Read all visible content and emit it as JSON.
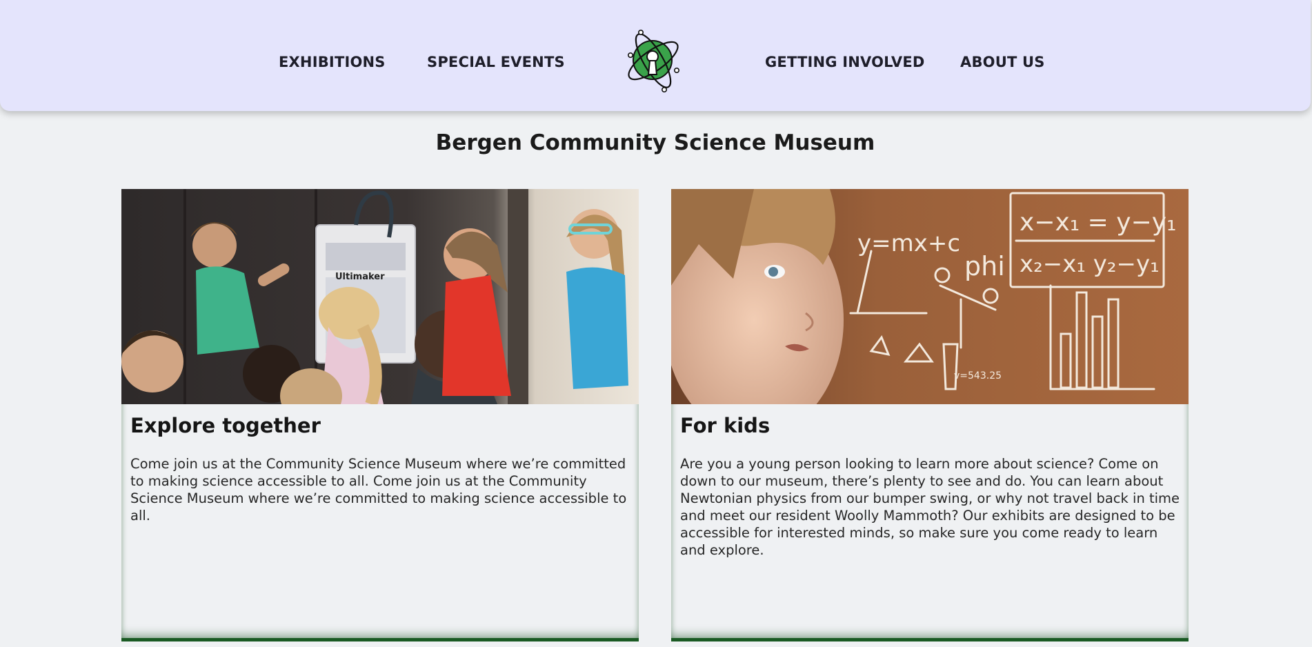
{
  "nav": {
    "exhibitions": "EXHIBITIONS",
    "special_events": "SPECIAL EVENTS",
    "getting_involved": "GETTING INVOLVED",
    "about_us": "ABOUT US",
    "logo_icon": "atom-keyhole-logo-icon"
  },
  "page": {
    "title": "Bergen Community Science Museum"
  },
  "cards": [
    {
      "heading": "Explore together",
      "body": "Come join us at the Community Science Museum where we’re committed to making science accessible to all. Come join us at the Community Science Museum where we’re committed to making science accessible to all.",
      "image_icon": "kids-3d-printer-photo",
      "printer_brand": "Ultimaker"
    },
    {
      "heading": "For kids",
      "body": "Are you a young person looking to learn more about science? Come on down to our museum, there’s plenty to see and do. You can learn about Newtonian physics from our bumper swing, or why not travel back in time and meet our resident Woolly Mammoth? Our exhibits are designed to be accessible for interested minds, so make sure you come ready to learn and explore.",
      "image_icon": "girl-chalkboard-math-photo"
    }
  ],
  "colors": {
    "header_bg": "#e4e4fc",
    "page_bg": "#eff1f3",
    "accent_green": "#1a5a23",
    "logo_green": "#3aa34a"
  }
}
